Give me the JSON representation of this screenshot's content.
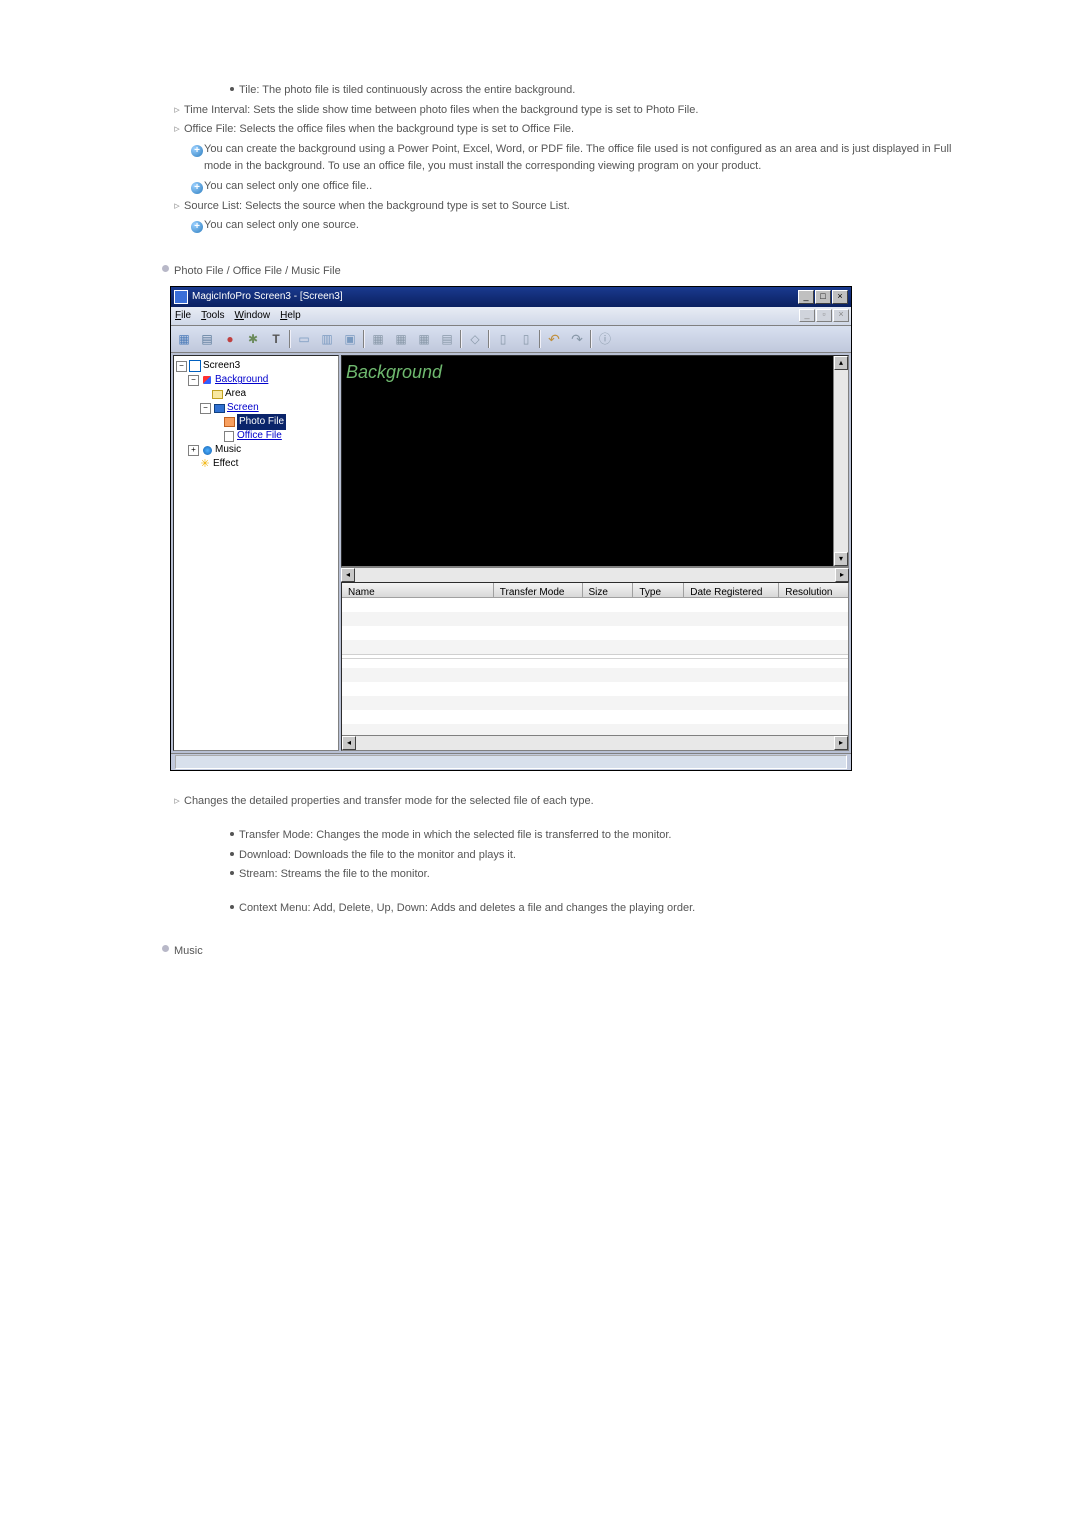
{
  "top_list": {
    "tile": "Tile: The photo file is tiled continuously across the entire background.",
    "time_interval": "Time Interval: Sets the slide show time between photo files when the background type is set to Photo File.",
    "office_file": "Office File: Selects the office files when the background type is set to Office File.",
    "office_note1": "You can create the background using a Power Point, Excel, Word, or PDF file. The office file used is not configured as an area and is just displayed in Full mode in the background. To use an office file, you must install the corresponding viewing program on your product.",
    "office_note2": "You can select only one office file..",
    "source_list": "Source List: Selects the source when the background type is set to Source List.",
    "source_note": "You can select only one source."
  },
  "section_title": "Photo File / Office File / Music File",
  "screenshot": {
    "title": "MagicInfoPro Screen3 - [Screen3]",
    "menu": {
      "file": "File",
      "tools": "Tools",
      "window": "Window",
      "help": "Help"
    },
    "toolbar_glyphs": [
      "▦",
      "▤",
      "●",
      "✱",
      "T",
      "▭",
      "▥",
      "▣",
      "▦",
      "▦",
      "▦",
      "▤",
      "◇",
      "▯",
      "▯",
      "↶",
      "↷",
      "⓿"
    ],
    "tree": {
      "root": "Screen3",
      "background": "Background",
      "area": "Area",
      "screen": "Screen",
      "photo_file": "Photo File",
      "office_file": "Office File",
      "music": "Music",
      "effect": "Effect"
    },
    "preview_label": "Background",
    "table_cols": {
      "name": "Name",
      "transfer": "Transfer Mode",
      "size": "Size",
      "type": "Type",
      "date": "Date Registered",
      "res": "Resolution"
    }
  },
  "below": {
    "intro": "Changes the detailed properties and transfer mode for the selected file of each type.",
    "b1": "Transfer Mode: Changes the mode in which the selected file is transferred to the monitor.",
    "b2": "Download: Downloads the file to the monitor and plays it.",
    "b3": "Stream: Streams the file to the monitor.",
    "b4": "Context Menu: Add, Delete, Up, Down: Adds and deletes a file and changes the playing order."
  },
  "music_label": "Music"
}
